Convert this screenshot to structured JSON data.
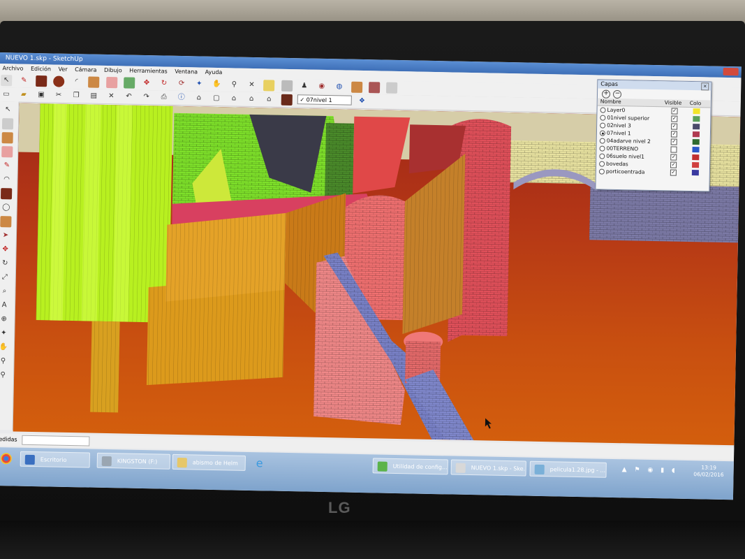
{
  "window": {
    "title": "NUEVO 1.skp - SketchUp"
  },
  "menu": [
    "Archivo",
    "Edición",
    "Ver",
    "Cámara",
    "Dibujo",
    "Herramientas",
    "Ventana",
    "Ayuda"
  ],
  "layer_select": {
    "value": "07nivel 1",
    "check": "✓"
  },
  "measures_label": "Medidas",
  "layers_panel": {
    "title": "Capas",
    "add": "+",
    "remove": "−",
    "col_name": "Nombre",
    "col_visible": "Visible",
    "col_color": "Colo",
    "rows": [
      {
        "name": "Layer0",
        "visible": true,
        "active": false,
        "color": "#f2e52a"
      },
      {
        "name": "01nivel superior",
        "visible": true,
        "active": false,
        "color": "#5aa05a"
      },
      {
        "name": "02nivel 3",
        "visible": true,
        "active": false,
        "color": "#4a4a6a"
      },
      {
        "name": "07nivel 1",
        "visible": true,
        "active": true,
        "color": "#b03a50"
      },
      {
        "name": "04adarve nivel 2",
        "visible": true,
        "active": false,
        "color": "#2f6a30"
      },
      {
        "name": "00TERRENO",
        "visible": false,
        "active": false,
        "color": "#2a58c8"
      },
      {
        "name": "06suelo nivel1",
        "visible": true,
        "active": false,
        "color": "#c03030"
      },
      {
        "name": "bovedas",
        "visible": true,
        "active": false,
        "color": "#d04040"
      },
      {
        "name": "porticoentrada",
        "visible": true,
        "active": false,
        "color": "#3a3aa0"
      }
    ]
  },
  "taskbar": {
    "items": [
      {
        "label": "Escritorio",
        "color": "#3a6fc0"
      },
      {
        "label": "KINGSTON (F:)",
        "color": "#9aa6b2"
      },
      {
        "label": "abismo de Helm",
        "color": "#e6c76a"
      },
      {
        "label": "Utilidad de config...",
        "color": "#5bb34a"
      },
      {
        "label": "NUEVO 1.skp - Ske...",
        "color": "#d8d8d8"
      },
      {
        "label": "pelicula1.28.jpg - ...",
        "color": "#7ab0d8"
      }
    ],
    "time": "13:19",
    "date": "06/02/2016"
  },
  "monitor_brand": "LG"
}
